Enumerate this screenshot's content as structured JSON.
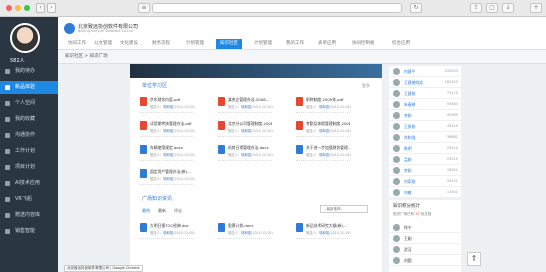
{
  "browser": {
    "url": ""
  },
  "user": {
    "name": "582人"
  },
  "sidebar": {
    "items": [
      {
        "label": "我的待办"
      },
      {
        "label": "新品体验"
      },
      {
        "label": "个人空间"
      },
      {
        "label": "我的收藏"
      },
      {
        "label": "沟通协作"
      },
      {
        "label": "工作计划"
      },
      {
        "label": "项目计划"
      },
      {
        "label": "AI技术应用"
      },
      {
        "label": "VR飞船"
      },
      {
        "label": "赠送内容库"
      },
      {
        "label": "销售智能"
      }
    ]
  },
  "header": {
    "company": "北京致远协创软件有限公司",
    "company_en": "Beijing Seeyon Software Co.Ltd",
    "tabs": [
      "协同工作",
      "公文管理",
      "文化建设",
      "财务流程",
      "计划管理",
      "知识社区",
      "计划管理",
      "我的工作",
      "表单应用",
      "协同控制板",
      "综合应用"
    ]
  },
  "breadcrumb": "知识社区 > 知识广场",
  "main": {
    "section1": {
      "title": "单位学习区",
      "more": "更多"
    },
    "docs": [
      {
        "title": "京东财务内容.pdf",
        "type": "pdf",
        "author": "徐和强",
        "date": "2014-12-05"
      },
      {
        "title": "某央企管理办法-2008...",
        "type": "pdf",
        "author": "徐和强",
        "date": "2014-12-05"
      },
      {
        "title": "职称制度-2009年.pdf",
        "type": "pdf",
        "author": "徐和强",
        "date": "2014-12-05"
      },
      {
        "title": "试用期考核管理办法.pdf",
        "type": "pdf",
        "author": "徐和强",
        "date": "2014-12-05"
      },
      {
        "title": "北京分公司管理制度-2008...",
        "type": "pdf",
        "author": "徐和强",
        "date": "2014-12-05"
      },
      {
        "title": "考勤及休假管理制度-2008...",
        "type": "pdf",
        "author": "徐和强",
        "date": "2014-12-05"
      },
      {
        "title": "车辆使用规定.docx",
        "type": "doc",
        "author": "徐和强",
        "date": "2014-12-05"
      },
      {
        "title": "机房日常管理办法.docx",
        "type": "doc",
        "author": "徐和强",
        "date": "2014-12-05"
      },
      {
        "title": "关于进一步加强财务管理...",
        "type": "doc",
        "author": "徐和强",
        "date": "2014-12-05"
      },
      {
        "title": "固定资产管理办法(新)...",
        "type": "doc",
        "author": "徐和强",
        "date": "2014-12-05"
      }
    ],
    "author_label": "推送人：",
    "section2": {
      "title": "广场知识资讯",
      "tabs": [
        "最热",
        "最新",
        "评论"
      ],
      "select": "--最新推荐--"
    },
    "docs2": [
      {
        "title": "大明日报TOC经典.doc",
        "type": "doc",
        "author": "徐和强",
        "date": "2014-12-05"
      },
      {
        "title": "股票计划.docx",
        "type": "doc",
        "author": "徐和强",
        "date": "2014-12-05"
      },
      {
        "title": "新品技术研究大纲(新)...",
        "type": "doc",
        "author": "徐和强",
        "date": "2014-12-05"
      }
    ]
  },
  "ranking": [
    {
      "name": "何建平",
      "value": "226303"
    },
    {
      "name": "王建美刚尧",
      "value": "182425"
    },
    {
      "name": "王建刚",
      "value": "73110"
    },
    {
      "name": "朱春晓",
      "value": "59483"
    },
    {
      "name": "李刚",
      "value": "45989"
    },
    {
      "name": "王俊刚",
      "value": "45210"
    },
    {
      "name": "徐和强",
      "value": "36681"
    },
    {
      "name": "陈明",
      "value": "29510"
    },
    {
      "name": "孟刚",
      "value": "25510"
    },
    {
      "name": "李刚",
      "value": "18551"
    },
    {
      "name": "刘家刚",
      "value": "16701"
    },
    {
      "name": "刘敏",
      "value": "14301"
    }
  ],
  "stats": {
    "title": "知识积分统计",
    "line1": "知识广场已有",
    "count": "33",
    "line1_end": "份文档",
    "people": [
      {
        "name": "徐宁"
      },
      {
        "name": "王刚"
      },
      {
        "name": "武汉"
      },
      {
        "name": "刘国"
      }
    ]
  },
  "status_text": "北京致远协创软件有限公司 | Google Chrome"
}
